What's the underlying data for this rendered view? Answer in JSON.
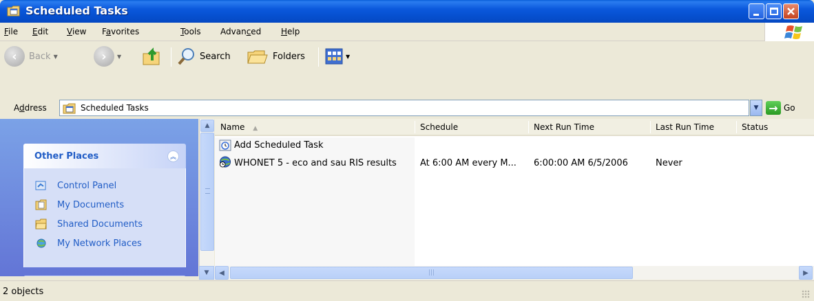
{
  "window": {
    "title": "Scheduled Tasks",
    "title_icon": "scheduled-tasks-folder-icon",
    "accent": "#0a5fd8"
  },
  "menu": {
    "items": [
      {
        "label": "File",
        "accel": "F",
        "rest": "ile"
      },
      {
        "label": "Edit",
        "accel": "E",
        "rest": "dit"
      },
      {
        "label": "View",
        "accel": "V",
        "rest": "iew"
      },
      {
        "label": "Favorites",
        "pre": "F",
        "accel": "a",
        "rest": "vorites"
      },
      {
        "label": "Tools",
        "accel": "T",
        "rest": "ools"
      },
      {
        "label": "Advanced",
        "pre": "Advan",
        "accel": "c",
        "rest": "ed"
      },
      {
        "label": "Help",
        "accel": "H",
        "rest": "elp"
      }
    ]
  },
  "toolbar": {
    "back_label": "Back",
    "search_label": "Search",
    "folders_label": "Folders"
  },
  "address": {
    "label_pre": "A",
    "label_accel": "d",
    "label_rest": "dress",
    "value": "Scheduled Tasks",
    "go_label": "Go"
  },
  "sidebar": {
    "panel_title": "Other Places",
    "places": [
      {
        "label": "Control Panel",
        "icon": "control-panel-icon",
        "color": "#3a7bd5"
      },
      {
        "label": "My Documents",
        "icon": "my-documents-icon",
        "color": "#f2c94c"
      },
      {
        "label": "Shared Documents",
        "icon": "shared-documents-icon",
        "color": "#f2c94c"
      },
      {
        "label": "My Network Places",
        "icon": "network-places-icon",
        "color": "#4aa3df"
      }
    ]
  },
  "list": {
    "columns": [
      "Name",
      "Schedule",
      "Next Run Time",
      "Last Run Time",
      "Status"
    ],
    "sort_indicator": "▲",
    "rows": [
      {
        "name": "Add Scheduled Task",
        "schedule": "",
        "next_run": "",
        "last_run": "",
        "status": "",
        "icon": "add-task-icon"
      },
      {
        "name": "WHONET 5 - eco and sau RIS results",
        "schedule": "At 6:00 AM every M...",
        "next_run": "6:00:00 AM  6/5/2006",
        "last_run": "Never",
        "status": "",
        "icon": "scheduled-task-icon"
      }
    ]
  },
  "status": {
    "text": "2 objects"
  }
}
